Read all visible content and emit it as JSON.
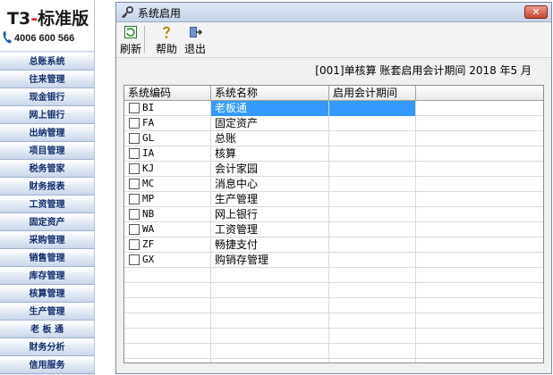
{
  "brand": {
    "title_prefix": "T3",
    "title_dash": "-",
    "title_suffix": "标准版",
    "phone": "4006 600 566"
  },
  "sidebar": {
    "items": [
      {
        "label": "总账系统"
      },
      {
        "label": "往来管理"
      },
      {
        "label": "现金银行"
      },
      {
        "label": "网上银行"
      },
      {
        "label": "出纳管理"
      },
      {
        "label": "项目管理"
      },
      {
        "label": "税务管家"
      },
      {
        "label": "财务报表"
      },
      {
        "label": "工资管理"
      },
      {
        "label": "固定资产"
      },
      {
        "label": "采购管理"
      },
      {
        "label": "销售管理"
      },
      {
        "label": "库存管理"
      },
      {
        "label": "核算管理"
      },
      {
        "label": "生产管理"
      },
      {
        "label": "老 板 通"
      },
      {
        "label": "财务分析"
      },
      {
        "label": "信用服务"
      }
    ]
  },
  "window": {
    "title": "系统启用",
    "close_label": "✕"
  },
  "toolbar": {
    "refresh_label": "刷新",
    "help_label": "帮助",
    "exit_label": "退出"
  },
  "period_text": "[001]单核算 账套启用会计期间 2018 年5 月",
  "table": {
    "headers": [
      "系统编码",
      "系统名称",
      "启用会计期间"
    ],
    "rows": [
      {
        "code": "BI",
        "name": "老板通",
        "period": "",
        "checked": false,
        "selected": true
      },
      {
        "code": "FA",
        "name": "固定资产",
        "period": "",
        "checked": false,
        "selected": false
      },
      {
        "code": "GL",
        "name": "总账",
        "period": "",
        "checked": false,
        "selected": false
      },
      {
        "code": "IA",
        "name": "核算",
        "period": "",
        "checked": false,
        "selected": false
      },
      {
        "code": "KJ",
        "name": "会计家园",
        "period": "",
        "checked": false,
        "selected": false
      },
      {
        "code": "MC",
        "name": "消息中心",
        "period": "",
        "checked": false,
        "selected": false
      },
      {
        "code": "MP",
        "name": "生产管理",
        "period": "",
        "checked": false,
        "selected": false
      },
      {
        "code": "NB",
        "name": "网上银行",
        "period": "",
        "checked": false,
        "selected": false
      },
      {
        "code": "WA",
        "name": "工资管理",
        "period": "",
        "checked": false,
        "selected": false
      },
      {
        "code": "ZF",
        "name": "畅捷支付",
        "period": "",
        "checked": false,
        "selected": false
      },
      {
        "code": "GX",
        "name": "购销存管理",
        "period": "",
        "checked": false,
        "selected": false
      }
    ]
  }
}
